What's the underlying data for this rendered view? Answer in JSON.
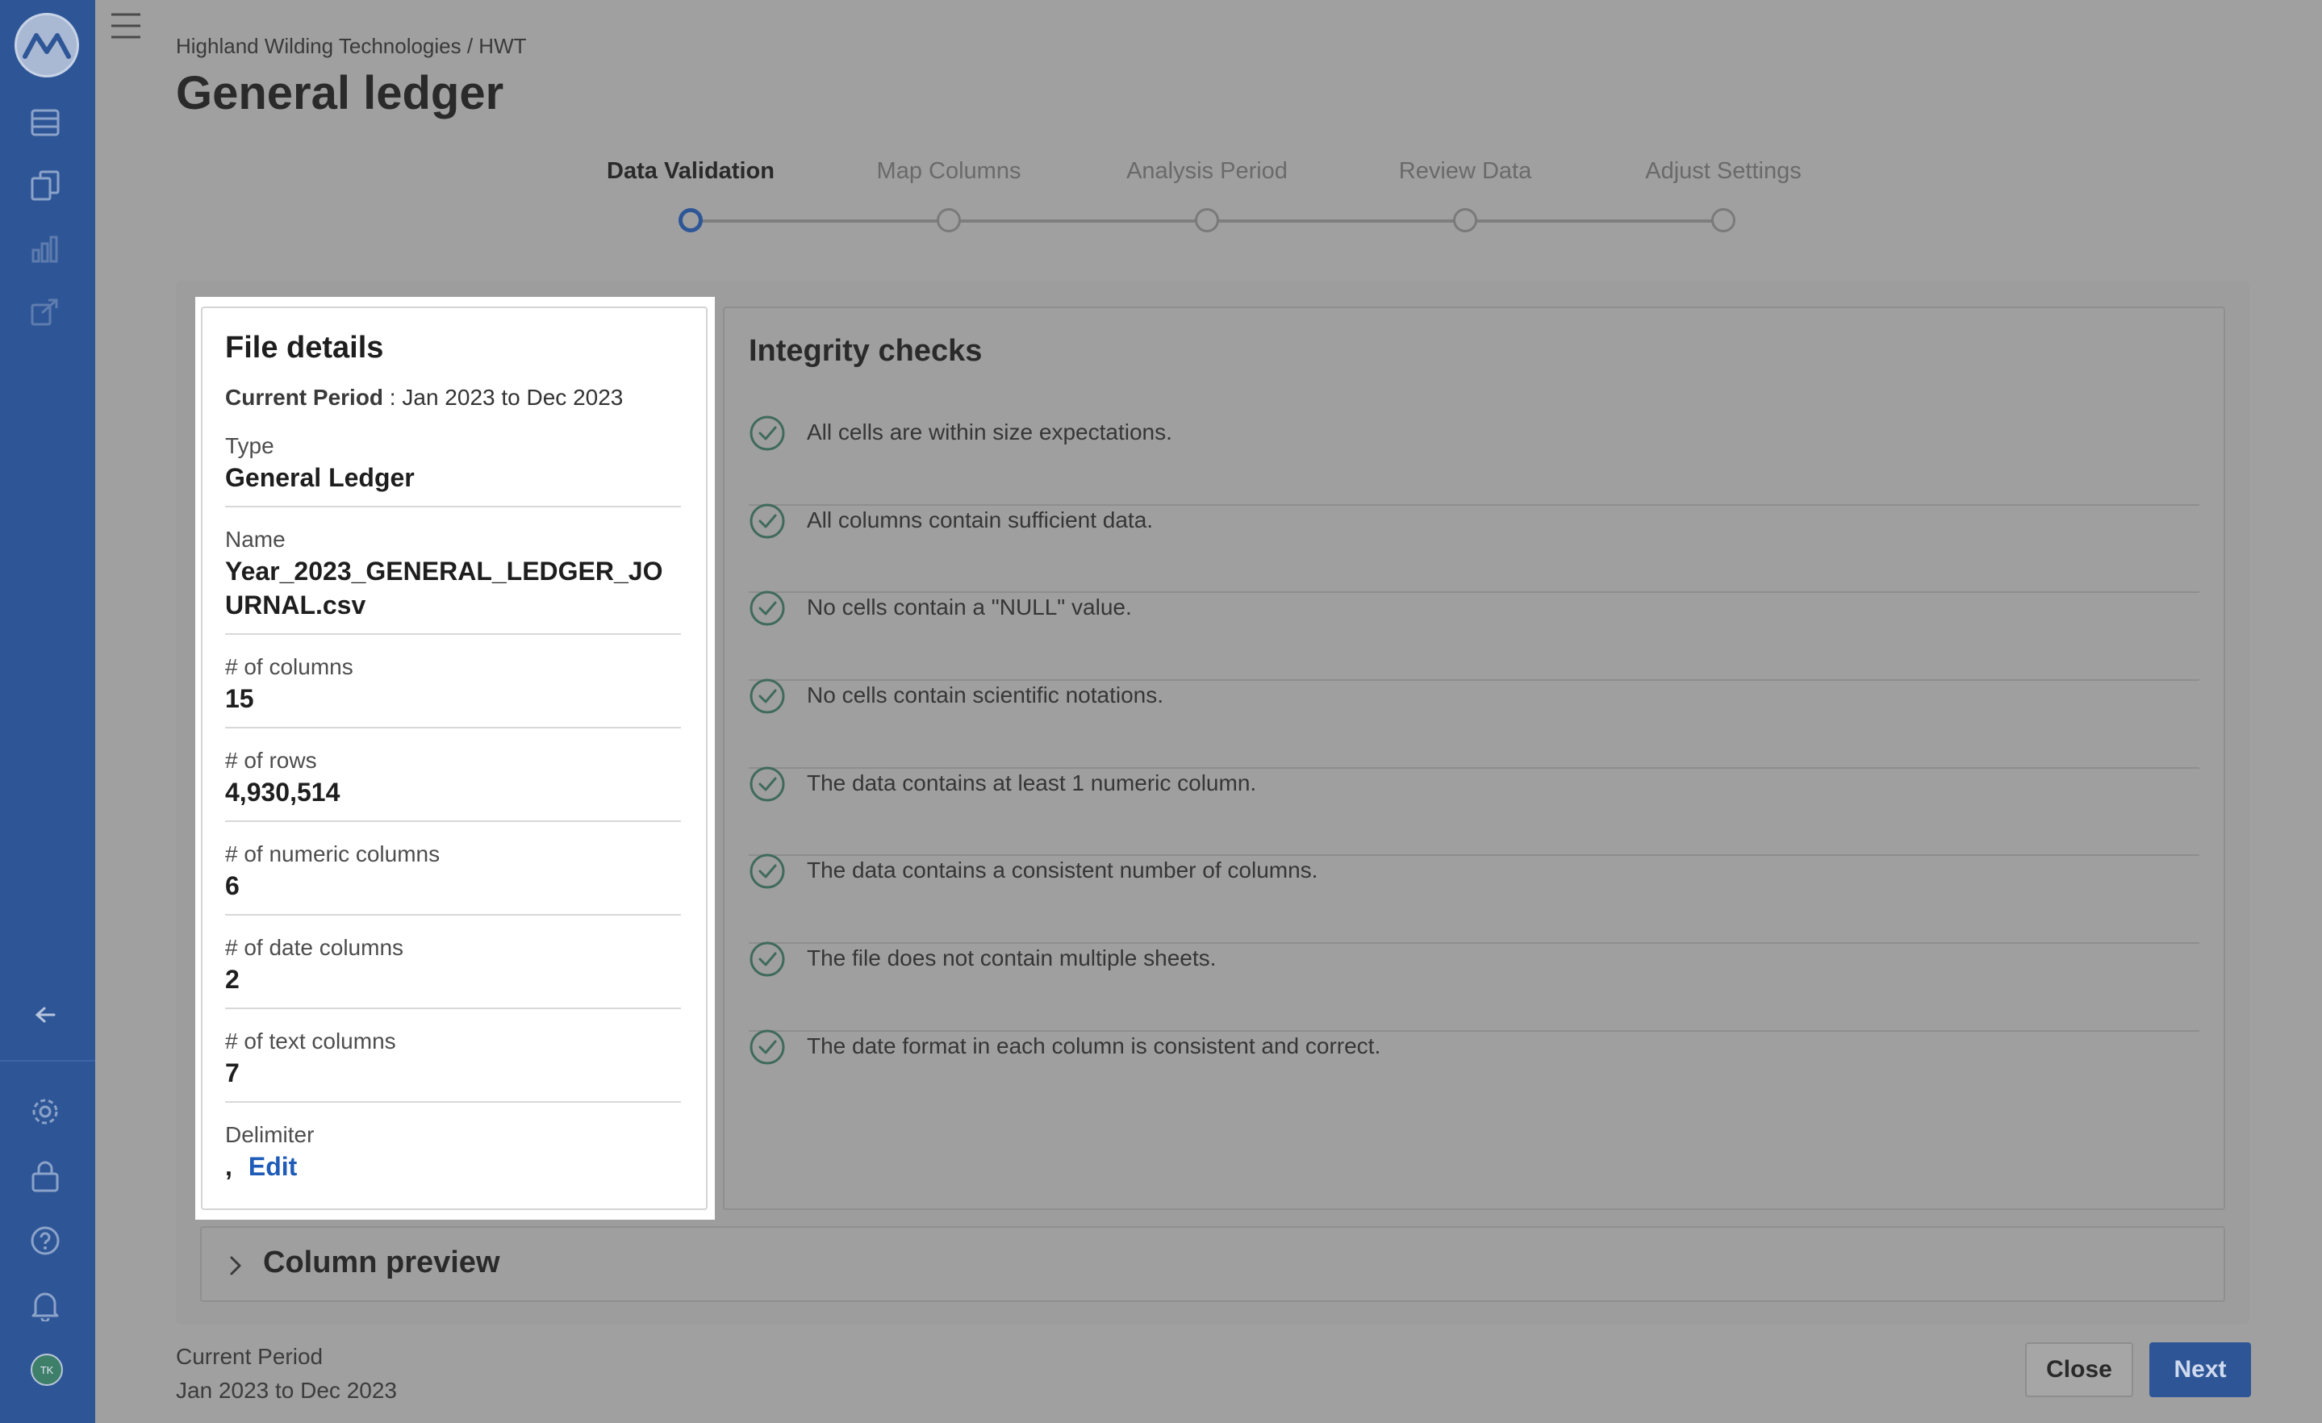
{
  "sidebar": {
    "nav_icons": [
      "data-table-icon",
      "documents-icon",
      "bar-chart-icon",
      "export-icon"
    ],
    "collapse_icon": "arrow-left-icon",
    "bottom_icons": [
      "gear-icon",
      "lock-icon",
      "help-icon",
      "bell-icon"
    ],
    "avatar_initials": "TK"
  },
  "header": {
    "breadcrumb": "Highland Wilding Technologies / HWT",
    "title": "General ledger"
  },
  "stepper": {
    "steps": [
      {
        "label": "Data Validation",
        "active": true
      },
      {
        "label": "Map Columns",
        "active": false
      },
      {
        "label": "Analysis Period",
        "active": false
      },
      {
        "label": "Review Data",
        "active": false
      },
      {
        "label": "Adjust Settings",
        "active": false
      }
    ]
  },
  "file_details": {
    "title": "File details",
    "period_label": "Current Period",
    "period_value": " : Jan 2023 to Dec 2023",
    "type_label": "Type",
    "type_value": "General Ledger",
    "name_label": "Name",
    "name_value": "Year_2023_GENERAL_LEDGER_JOURNAL.csv",
    "columns_label": "# of columns",
    "columns_value": "15",
    "rows_label": "# of rows",
    "rows_value": "4,930,514",
    "numeric_label": "# of numeric columns",
    "numeric_value": "6",
    "date_label": "# of date columns",
    "date_value": "2",
    "text_label": "# of text columns",
    "text_value": "7",
    "delimiter_label": "Delimiter",
    "delimiter_value": ",",
    "edit_label": "Edit"
  },
  "integrity": {
    "title": "Integrity checks",
    "checks": [
      "All cells are within size expectations.",
      "All columns contain sufficient data.",
      "No cells contain a \"NULL\" value.",
      "No cells contain scientific notations.",
      "The data contains at least 1 numeric column.",
      "The data contains a consistent number of columns.",
      "The file does not contain multiple sheets.",
      "The date format in each column is consistent and correct."
    ]
  },
  "column_preview": {
    "label": "Column preview"
  },
  "footer": {
    "period_label": "Current Period",
    "period_value": "Jan 2023 to Dec 2023",
    "close_label": "Close",
    "next_label": "Next"
  },
  "colors": {
    "brand": "#2e5697",
    "link": "#1f5bb8",
    "check": "#3f6a5c"
  }
}
